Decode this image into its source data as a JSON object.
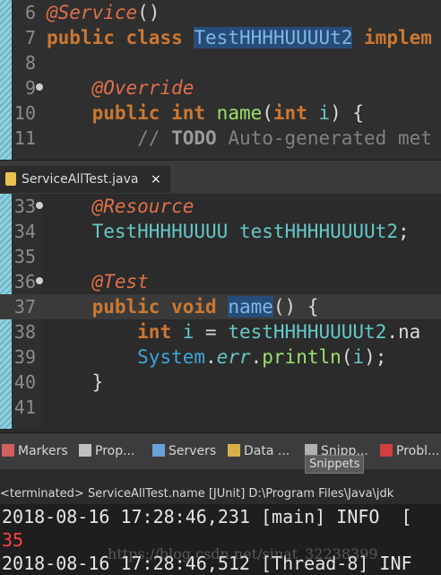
{
  "top_editor": {
    "lines": [
      {
        "num": "6",
        "parts": [
          [
            "ann",
            "@Service"
          ],
          [
            "",
            "()"
          ]
        ]
      },
      {
        "num": "7",
        "parts": [
          [
            "kw",
            "public "
          ],
          [
            "kw",
            "class "
          ],
          [
            "sel",
            "TestHHHHUUUUt2"
          ],
          [
            "kw",
            " implem"
          ]
        ]
      },
      {
        "num": "8",
        "parts": []
      },
      {
        "num": "9",
        "fold": true,
        "parts": [
          [
            "",
            "    "
          ],
          [
            "ann",
            "@Override"
          ]
        ]
      },
      {
        "num": "10",
        "parts": [
          [
            "",
            "    "
          ],
          [
            "kw",
            "public "
          ],
          [
            "kw",
            "int "
          ],
          [
            "mth",
            "name"
          ],
          [
            "",
            "("
          ],
          [
            "kw",
            "int "
          ],
          [
            "var",
            "i"
          ],
          [
            "",
            ") {"
          ]
        ]
      },
      {
        "num": "11",
        "parts": [
          [
            "",
            "        "
          ],
          [
            "cmt",
            "// "
          ],
          [
            "todo",
            "TODO "
          ],
          [
            "cmt",
            "Auto-generated met"
          ]
        ]
      }
    ]
  },
  "tab": {
    "label": "ServiceAllTest.java",
    "close": "×"
  },
  "bottom_editor": {
    "lines": [
      {
        "num": "33",
        "fold": true,
        "parts": [
          [
            "",
            "    "
          ],
          [
            "ann",
            "@Resource"
          ]
        ]
      },
      {
        "num": "34",
        "parts": [
          [
            "",
            "    "
          ],
          [
            "typ",
            "TestHHHHUUUU "
          ],
          [
            "typ",
            "testHHHHUUUUt2"
          ],
          [
            "",
            ";"
          ]
        ]
      },
      {
        "num": "35",
        "parts": []
      },
      {
        "num": "36",
        "fold": true,
        "parts": [
          [
            "",
            "    "
          ],
          [
            "ann",
            "@Test"
          ]
        ]
      },
      {
        "num": "37",
        "current": true,
        "parts": [
          [
            "",
            "    "
          ],
          [
            "kw",
            "public "
          ],
          [
            "kw",
            "void "
          ],
          [
            "sel",
            "name"
          ],
          [
            "",
            "() {"
          ]
        ]
      },
      {
        "num": "38",
        "parts": [
          [
            "",
            "        "
          ],
          [
            "kw",
            "int "
          ],
          [
            "var",
            "i"
          ],
          [
            "",
            " = "
          ],
          [
            "typ",
            "testHHHHUUUUt2"
          ],
          [
            "",
            ".na"
          ]
        ]
      },
      {
        "num": "39",
        "parts": [
          [
            "",
            "        "
          ],
          [
            "sys",
            "System"
          ],
          [
            "",
            "."
          ],
          [
            "fld",
            "err"
          ],
          [
            "",
            "."
          ],
          [
            "mth",
            "println"
          ],
          [
            "",
            "("
          ],
          [
            "var",
            "i"
          ],
          [
            "",
            ");"
          ]
        ]
      },
      {
        "num": "40",
        "parts": [
          [
            "",
            "    }"
          ]
        ]
      },
      {
        "num": "41",
        "parts": []
      }
    ]
  },
  "views": [
    {
      "label": "Markers",
      "icon": "markers-icon",
      "color": "#d06060"
    },
    {
      "label": "Prop...",
      "icon": "properties-icon",
      "color": "#c0c0c0"
    },
    {
      "label": "Servers",
      "icon": "servers-icon",
      "color": "#6aa0d8"
    },
    {
      "label": "Data ...",
      "icon": "data-source-icon",
      "color": "#d8b04a"
    },
    {
      "label": "Snipp...",
      "icon": "snippets-icon",
      "color": "#b0b0b0"
    },
    {
      "label": "Probl...",
      "icon": "problems-icon",
      "color": "#d04040"
    }
  ],
  "tooltip": "Snippets",
  "console": {
    "header": "<terminated> ServiceAllTest.name [JUnit] D:\\Program Files\\Java\\jdk",
    "lines": [
      {
        "text": "2018-08-16 17:28:46,231 [main] INFO  [",
        "err": false
      },
      {
        "text": "35",
        "err": true
      },
      {
        "text": "2018-08-16 17:28:46,512 [Thread-8] INF",
        "err": false
      }
    ],
    "watermark": "https://blog.csdn.net/sinat_32238399"
  }
}
